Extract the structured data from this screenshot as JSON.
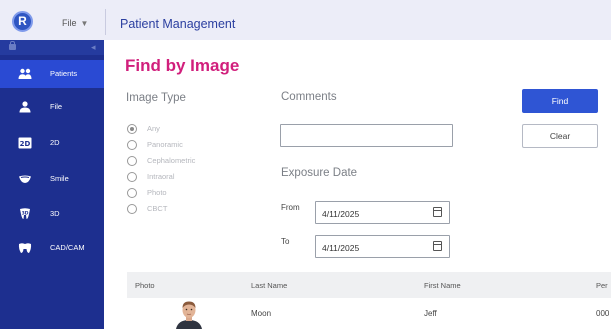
{
  "app": {
    "logo_letter": "R",
    "file_menu": "File",
    "module_title": "Patient Management"
  },
  "sidebar": {
    "items": [
      {
        "label": "Patients",
        "icon": "patients-icon",
        "active": true
      },
      {
        "label": "File",
        "icon": "person-icon",
        "active": false
      },
      {
        "label": "2D",
        "icon": "2d-icon",
        "active": false
      },
      {
        "label": "Smile",
        "icon": "smile-icon",
        "active": false
      },
      {
        "label": "3D",
        "icon": "3d-icon",
        "active": false
      },
      {
        "label": "CAD/CAM",
        "icon": "cadcam-icon",
        "active": false
      }
    ]
  },
  "find": {
    "title": "Find by Image",
    "image_type_label": "Image Type",
    "image_types": [
      {
        "label": "Any",
        "checked": true
      },
      {
        "label": "Panoramic",
        "checked": false
      },
      {
        "label": "Cephalometric",
        "checked": false
      },
      {
        "label": "Intraoral",
        "checked": false
      },
      {
        "label": "Photo",
        "checked": false
      },
      {
        "label": "CBCT",
        "checked": false
      }
    ],
    "comments_label": "Comments",
    "comments_value": "",
    "exposure_label": "Exposure Date",
    "from_label": "From",
    "from_value": "4/11/2025",
    "to_label": "To",
    "to_value": "4/11/2025",
    "find_button": "Find",
    "clear_button": "Clear"
  },
  "table": {
    "columns": [
      "Photo",
      "Last Name",
      "First Name",
      "Per"
    ],
    "rows": [
      {
        "last_name": "Moon",
        "first_name": "Jeff",
        "partial": "000"
      }
    ]
  },
  "colors": {
    "accent": "#2f55d4",
    "title": "#d11f7c",
    "sidebar": "#1d2f8f",
    "sidebar_active": "#2a4ad3"
  }
}
